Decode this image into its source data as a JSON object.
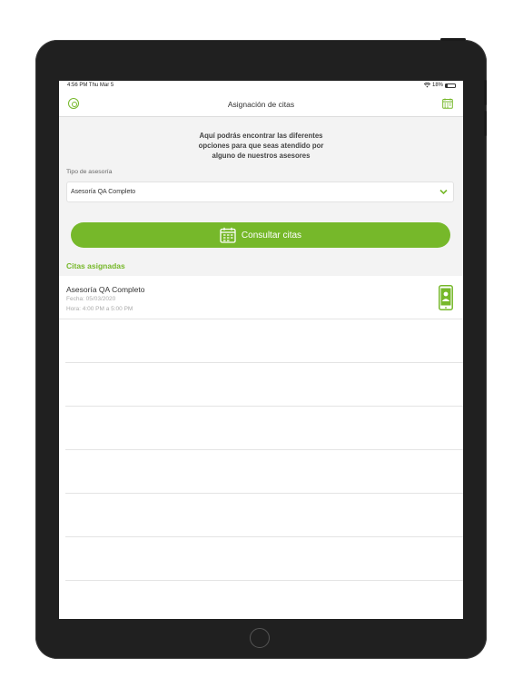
{
  "status_bar": {
    "time": "4:56 PM  Thu Mar 5",
    "battery": "18%"
  },
  "nav": {
    "title": "Asignación de citas"
  },
  "intro": {
    "line1": "Aquí podrás encontrar las diferentes",
    "line2": "opciones para que seas atendido por",
    "line3": "alguno de nuestros asesores"
  },
  "form": {
    "tipo_label": "Tipo de asesoría",
    "tipo_value": "Asesoría QA Completo",
    "button_label": "Consultar citas"
  },
  "section_title": "Citas asignadas",
  "citas": [
    {
      "name": "Asesoría QA Completo",
      "fecha": "Fecha:  05/03/2020",
      "hora": "Hora:   4:00 PM a 5:00 PM"
    }
  ],
  "colors": {
    "accent": "#76b82a",
    "bezel": "#202020"
  },
  "icons": {
    "nav_left": "target-icon",
    "nav_right": "calendar-icon",
    "button": "calendar-icon",
    "row": "smartphone-user-icon"
  }
}
